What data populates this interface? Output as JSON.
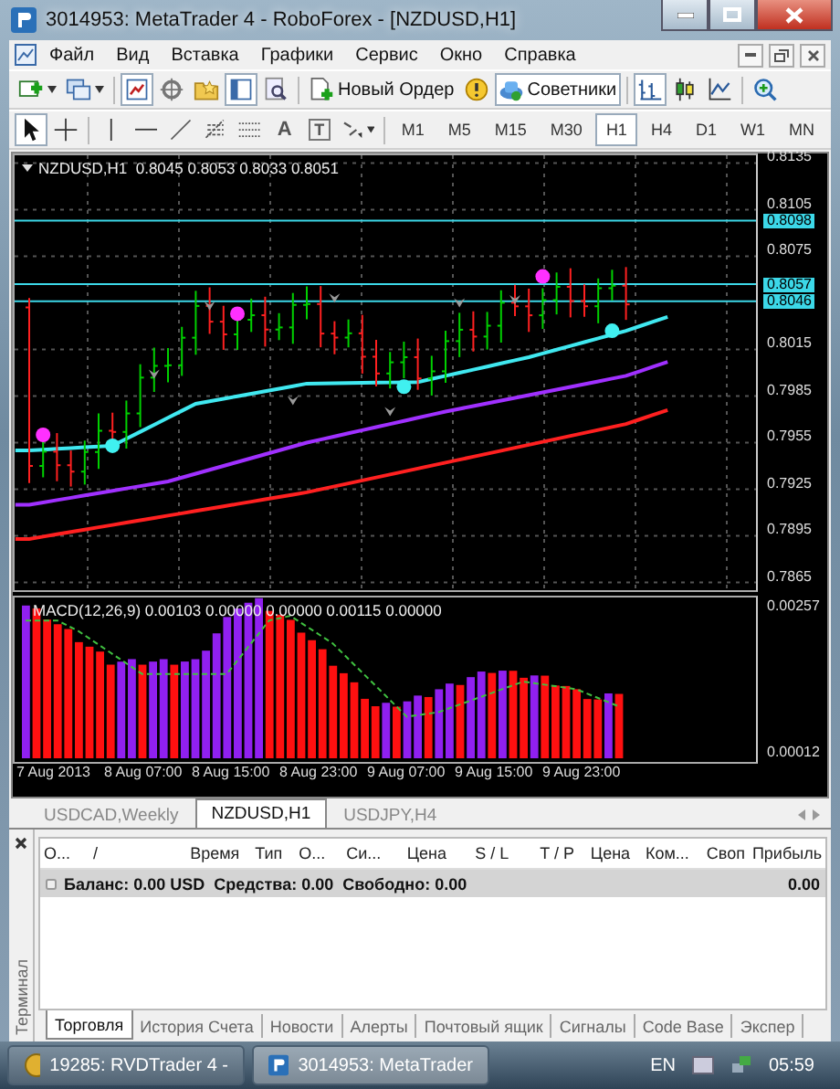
{
  "window": {
    "title": "3014953: MetaTrader 4 - RoboForex - [NZDUSD,H1]"
  },
  "menu": [
    "Файл",
    "Вид",
    "Вставка",
    "Графики",
    "Сервис",
    "Окно",
    "Справка"
  ],
  "toolbar": [
    {
      "kind": "new-chart",
      "selected": false
    },
    {
      "kind": "profiles",
      "selected": false
    },
    {
      "kind": "market-watch",
      "selected": true
    },
    {
      "kind": "navigator",
      "selected": false
    },
    {
      "kind": "favorites",
      "selected": false
    },
    {
      "kind": "terminal",
      "selected": true
    },
    {
      "kind": "tester",
      "selected": false
    },
    {
      "kind": "new-order",
      "label": "Новый Ордер",
      "selected": false
    },
    {
      "kind": "alert",
      "selected": false
    },
    {
      "kind": "experts",
      "label": "Советники",
      "selected": true
    },
    {
      "kind": "bar-chart",
      "selected": true
    },
    {
      "kind": "candles",
      "selected": false
    },
    {
      "kind": "line-chart",
      "selected": false
    },
    {
      "kind": "zoom-in",
      "selected": false
    }
  ],
  "tools": [
    {
      "kind": "cursor",
      "selected": true
    },
    {
      "kind": "crosshair",
      "selected": false
    },
    {
      "kind": "vertical-line",
      "selected": false
    },
    {
      "kind": "horizontal-line",
      "selected": false
    },
    {
      "kind": "trend-line",
      "selected": false
    },
    {
      "kind": "fibonacci",
      "selected": false
    },
    {
      "kind": "channel",
      "selected": false
    },
    {
      "kind": "text",
      "label": "A",
      "selected": false
    },
    {
      "kind": "text-label",
      "label": "T",
      "selected": false
    },
    {
      "kind": "arrows",
      "selected": false
    }
  ],
  "timeframes": [
    {
      "label": "M1",
      "selected": false
    },
    {
      "label": "M5",
      "selected": false
    },
    {
      "label": "M15",
      "selected": false
    },
    {
      "label": "M30",
      "selected": false
    },
    {
      "label": "H1",
      "selected": true
    },
    {
      "label": "H4",
      "selected": false
    },
    {
      "label": "D1",
      "selected": false
    },
    {
      "label": "W1",
      "selected": false
    },
    {
      "label": "MN",
      "selected": false
    }
  ],
  "chart": {
    "header": "NZDUSD,H1  0.8045 0.8053 0.8033 0.8051",
    "price_axis": [
      "0.8135",
      "0.8105",
      "0.8075",
      "0.8015",
      "0.7985",
      "0.7955",
      "0.7925",
      "0.7895",
      "0.7865"
    ],
    "levels": [
      "0.8098",
      "0.8057",
      "0.8046"
    ],
    "macd_label": "MACD(12,26,9) 0.00103 0.00000 0.00000 0.00115 0.00000",
    "macd_axis": [
      "0.00257",
      "0.00012"
    ],
    "time_axis": [
      "7 Aug 2013",
      "8 Aug 07:00",
      "8 Aug 15:00",
      "8 Aug 23:00",
      "9 Aug 07:00",
      "9 Aug 15:00",
      "9 Aug 23:00"
    ]
  },
  "chart_tabs": [
    {
      "label": "USDCAD,Weekly",
      "selected": false
    },
    {
      "label": "NZDUSD,H1",
      "selected": true
    },
    {
      "label": "USDJPY,H4",
      "selected": false
    }
  ],
  "terminal": {
    "title": "Терминал",
    "columns": [
      "О...",
      "/",
      "Время",
      "Тип",
      "О...",
      "Си...",
      "Цена",
      "S / L",
      "T / P",
      "Цена",
      "Ком...",
      "Своп",
      "Прибыль"
    ],
    "balance": "Баланс: 0.00 USD  Средства: 0.00  Свободно: 0.00",
    "profit": "0.00",
    "tabs": [
      {
        "label": "Торговля",
        "selected": true
      },
      {
        "label": "История Счета",
        "selected": false
      },
      {
        "label": "Новости",
        "selected": false
      },
      {
        "label": "Алерты",
        "selected": false
      },
      {
        "label": "Почтовый ящик",
        "selected": false
      },
      {
        "label": "Сигналы",
        "selected": false
      },
      {
        "label": "Code Base",
        "selected": false
      },
      {
        "label": "Экспер",
        "selected": false
      }
    ]
  },
  "taskbar": {
    "tasks": [
      {
        "label": "19285: RVDTrader 4 -",
        "selected": false
      },
      {
        "label": "3014953: MetaTrader",
        "selected": true
      }
    ],
    "language": "EN",
    "clock": "05:59"
  }
}
